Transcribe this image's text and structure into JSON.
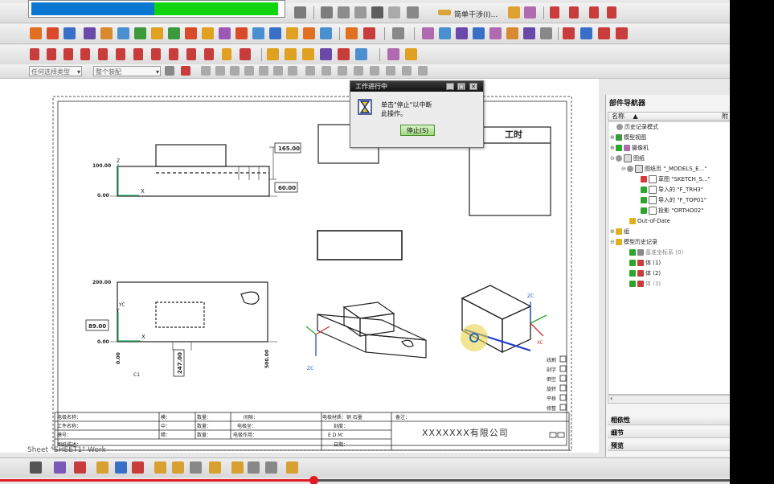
{
  "dialog": {
    "title": "工作进行中",
    "message_line1": "单击\"停止\"以中断",
    "message_line2": "此操作。",
    "stop_button": "停止(S)",
    "min": "_",
    "max": "□",
    "close": "✕"
  },
  "toolbar": {
    "simple_interference": "简单干涉(I)...",
    "filter_selector": "任何选择类型",
    "scope_selector": "整个装配"
  },
  "progress": {
    "value": 0.5
  },
  "drawing": {
    "dim_165": "165.00",
    "dim_60": "60.00",
    "dim_89": "89.00",
    "dim_247": "247.00",
    "y100": "100.00",
    "y000a": "0.00",
    "y200": "200.00",
    "y000b": "0.00",
    "x_zero": "0.00",
    "x_500": "500.00",
    "label_x": "X",
    "label_z": "Z",
    "label_y": "Y",
    "label_xc": "XC",
    "label_yc": "YC",
    "label_zc": "ZC",
    "label_c1": "C1",
    "worktime_title": "工时",
    "company": "XXXXXXX有限公司",
    "sheet_label": "Sheet \"SHEET1\" Work",
    "tb_row1": [
      "电极名称：",
      "模：",
      "数量：",
      "间隙：",
      "电极材质：铜 石墨",
      "备注："
    ],
    "tb_row2": [
      "工件名称：",
      "中：",
      "数量：",
      "电极坐：",
      "刻度：",
      ""
    ],
    "tb_row3": [
      "模号：",
      "精：",
      "数量：",
      "电极作用：",
      "E D M：",
      ""
    ],
    "tb_row4": [
      "图纸描述：",
      "",
      "",
      "",
      "日期：",
      ""
    ],
    "checkbox_labels": [
      "线割",
      "刻字",
      "倒空",
      "旋转",
      "平移",
      "修整"
    ]
  },
  "navigator": {
    "title": "部件导航器",
    "column_name": "名称",
    "column_sort": "▲",
    "column_extra": "附",
    "items": [
      "历史记录模式",
      "模型视图",
      "摄像机",
      "图纸",
      "图纸页 \"_MODELS_E...\"",
      "草图 \"SKETCH_S...\"",
      "导入的 \"F_TRH3\"",
      "导入的 \"F_TOP01\"",
      "投影 \"ORTHO02\"",
      "Out-of-Date",
      "组",
      "模型历史记录",
      "基准坐标系 (0)",
      "体 (1)",
      "体 (2)",
      "体 (3)"
    ],
    "sections": [
      "相依性",
      "细节",
      "预览"
    ]
  }
}
